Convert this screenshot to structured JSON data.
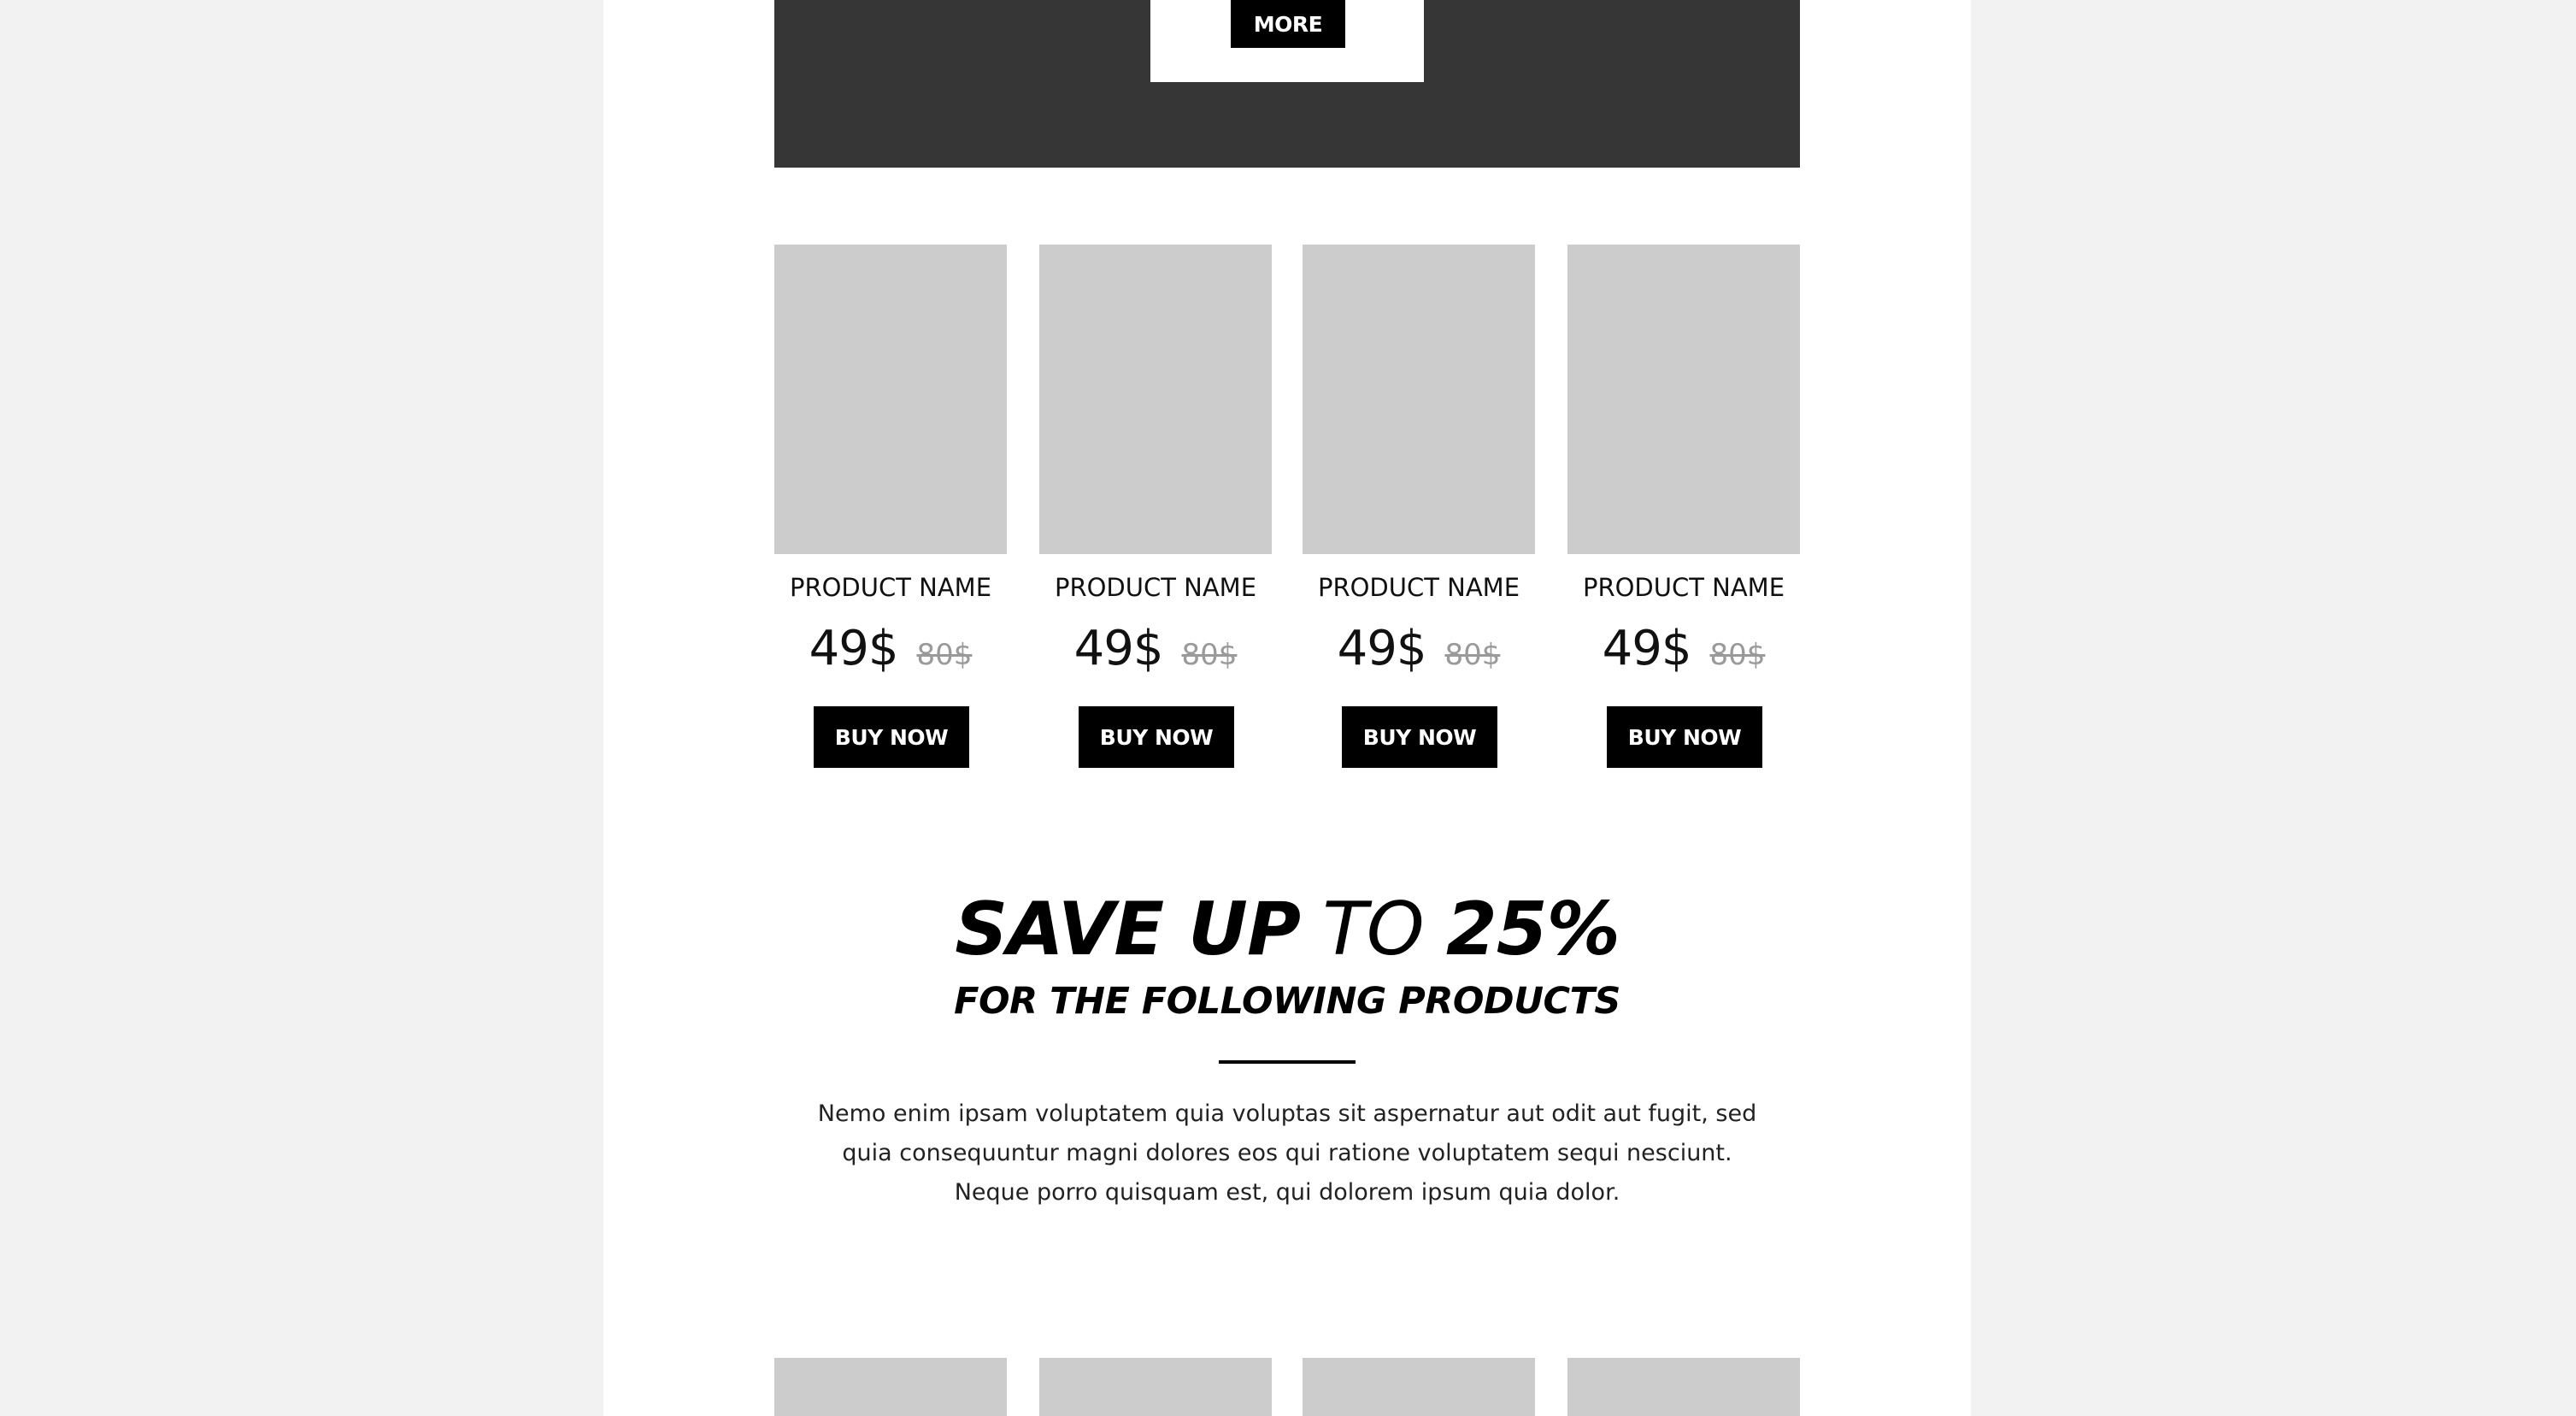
{
  "hero": {
    "button_label": "MORE"
  },
  "products": [
    {
      "name": "PRODUCT NAME",
      "price": "49$",
      "old_price": "80$",
      "button_label": "BUY NOW"
    },
    {
      "name": "PRODUCT NAME",
      "price": "49$",
      "old_price": "80$",
      "button_label": "BUY NOW"
    },
    {
      "name": "PRODUCT NAME",
      "price": "49$",
      "old_price": "80$",
      "button_label": "BUY NOW"
    },
    {
      "name": "PRODUCT NAME",
      "price": "49$",
      "old_price": "80$",
      "button_label": "BUY NOW"
    }
  ],
  "promo": {
    "headline_part1": "SAVE UP",
    "headline_part2": "TO",
    "headline_part3": "25%",
    "subheadline": "FOR THE FOLLOWING PRODUCTS",
    "body": "Nemo enim ipsam voluptatem quia voluptas sit aspernatur aut odit aut fugit, sed quia consequuntur magni dolores eos qui ratione voluptatem sequi nesciunt. Neque porro quisquam est, qui dolorem ipsum quia dolor."
  },
  "colors": {
    "page_background": "#f2f2f2",
    "email_background": "#ffffff",
    "hero_background": "#363636",
    "placeholder_image": "#cccccc",
    "button": "#000000",
    "old_price": "#9a9a9a"
  }
}
